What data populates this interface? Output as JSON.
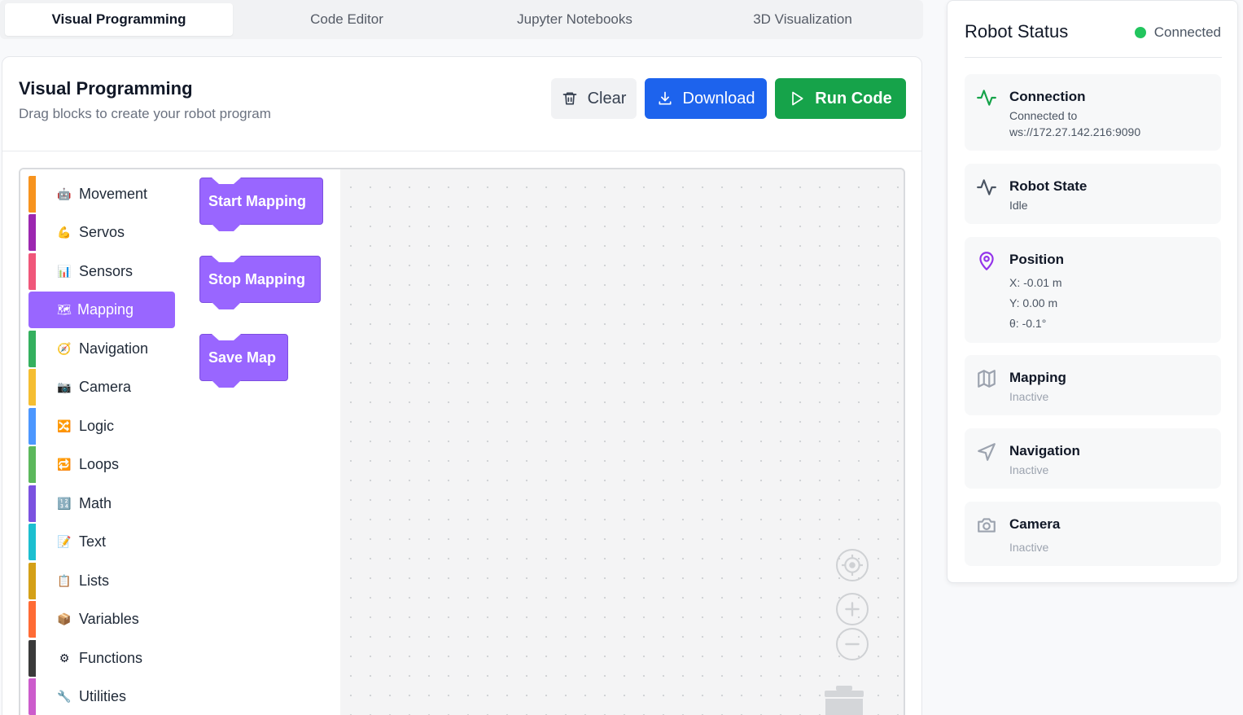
{
  "tabs": [
    {
      "label": "Visual Programming",
      "active": true
    },
    {
      "label": "Code Editor"
    },
    {
      "label": "Jupyter Notebooks"
    },
    {
      "label": "3D Visualization"
    }
  ],
  "header": {
    "title": "Visual Programming",
    "subtitle": "Drag blocks to create your robot program",
    "clear_label": "Clear",
    "download_label": "Download",
    "run_label": "Run Code"
  },
  "toolbox": {
    "categories": [
      {
        "label": "Movement",
        "color": "#f7931e",
        "icon": "robot-icon",
        "glyph": "🤖"
      },
      {
        "label": "Servos",
        "color": "#9c27b0",
        "icon": "arm-icon",
        "glyph": "💪"
      },
      {
        "label": "Sensors",
        "color": "#f0577a",
        "icon": "chart-icon",
        "glyph": "📊"
      },
      {
        "label": "Mapping",
        "color": "#9966ff",
        "icon": "map-icon",
        "glyph": "🗺",
        "selected": true
      },
      {
        "label": "Navigation",
        "color": "#34b05e",
        "icon": "compass-icon",
        "glyph": "🧭"
      },
      {
        "label": "Camera",
        "color": "#f5be32",
        "icon": "camera-icon",
        "glyph": "📷"
      },
      {
        "label": "Logic",
        "color": "#4c97ff",
        "icon": "shuffle-icon",
        "glyph": "🔀"
      },
      {
        "label": "Loops",
        "color": "#5cb85c",
        "icon": "repeat-icon",
        "glyph": "🔁"
      },
      {
        "label": "Math",
        "color": "#7b52e0",
        "icon": "numbers-icon",
        "glyph": "🔢"
      },
      {
        "label": "Text",
        "color": "#1cbfd0",
        "icon": "memo-icon",
        "glyph": "📝"
      },
      {
        "label": "Lists",
        "color": "#d4a017",
        "icon": "clipboard-icon",
        "glyph": "📋"
      },
      {
        "label": "Variables",
        "color": "#ff6b35",
        "icon": "package-icon",
        "glyph": "📦"
      },
      {
        "label": "Functions",
        "color": "#3a3a3a",
        "icon": "gear-icon",
        "glyph": "⚙"
      },
      {
        "label": "Utilities",
        "color": "#cc5ccc",
        "icon": "wrench-icon",
        "glyph": "🔧"
      }
    ]
  },
  "blocks": [
    {
      "label": "Start Mapping"
    },
    {
      "label": "Stop Mapping"
    },
    {
      "label": "Save Map"
    }
  ],
  "status": {
    "title": "Robot Status",
    "connection_badge": "Connected",
    "cards": {
      "connection": {
        "title": "Connection",
        "line1": "Connected to",
        "line2": "ws://172.27.142.216:9090"
      },
      "robot_state": {
        "title": "Robot State",
        "value": "Idle"
      },
      "position": {
        "title": "Position",
        "x": "X: -0.01 m",
        "y": "Y: 0.00 m",
        "theta": "θ: -0.1°"
      },
      "mapping": {
        "title": "Mapping",
        "value": "Inactive"
      },
      "navigation": {
        "title": "Navigation",
        "value": "Inactive"
      },
      "camera": {
        "title": "Camera",
        "value": "Inactive"
      }
    }
  },
  "colors": {
    "accent_blue": "#1d63ed",
    "run_green": "#16a34a",
    "mapping_purple": "#9966ff",
    "status_green": "#22c55e",
    "activity_green": "#16a34a",
    "position_purple": "#9333ea"
  }
}
